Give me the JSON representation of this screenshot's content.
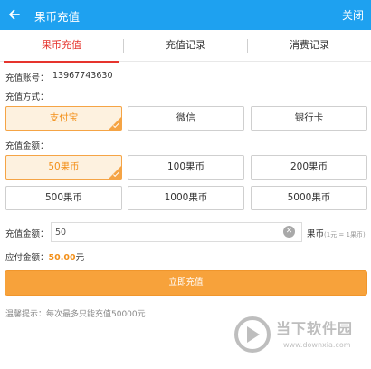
{
  "header": {
    "title": "果币充值",
    "close_label": "关闭"
  },
  "tabs": [
    {
      "label": "果币充值",
      "active": true
    },
    {
      "label": "充值记录",
      "active": false
    },
    {
      "label": "消费记录",
      "active": false
    }
  ],
  "account": {
    "label": "充值账号：",
    "value": "13967743630"
  },
  "pay_method": {
    "label": "充值方式：",
    "options": [
      "支付宝",
      "微信",
      "银行卡"
    ],
    "selected": "支付宝"
  },
  "amount_options": {
    "label": "充值金额：",
    "options": [
      "50果币",
      "100果币",
      "200果币",
      "500果币",
      "1000果币",
      "5000果币"
    ],
    "selected": "50果币"
  },
  "amount_input": {
    "label": "充值金额：",
    "value": "50",
    "unit": "果币",
    "rate_note": "(1元 = 1果币)"
  },
  "payable": {
    "label": "应付金额：",
    "value": "50.00",
    "currency": "元"
  },
  "submit_label": "立即充值",
  "tip": "温馨提示：每次最多只能充值50000元",
  "watermark": {
    "text": "当下软件园",
    "url": "www.downxia.com"
  },
  "colors": {
    "header": "#1ea1f0",
    "accent_red": "#e6342d",
    "accent_orange": "#f3901a",
    "button": "#f7a23b"
  }
}
